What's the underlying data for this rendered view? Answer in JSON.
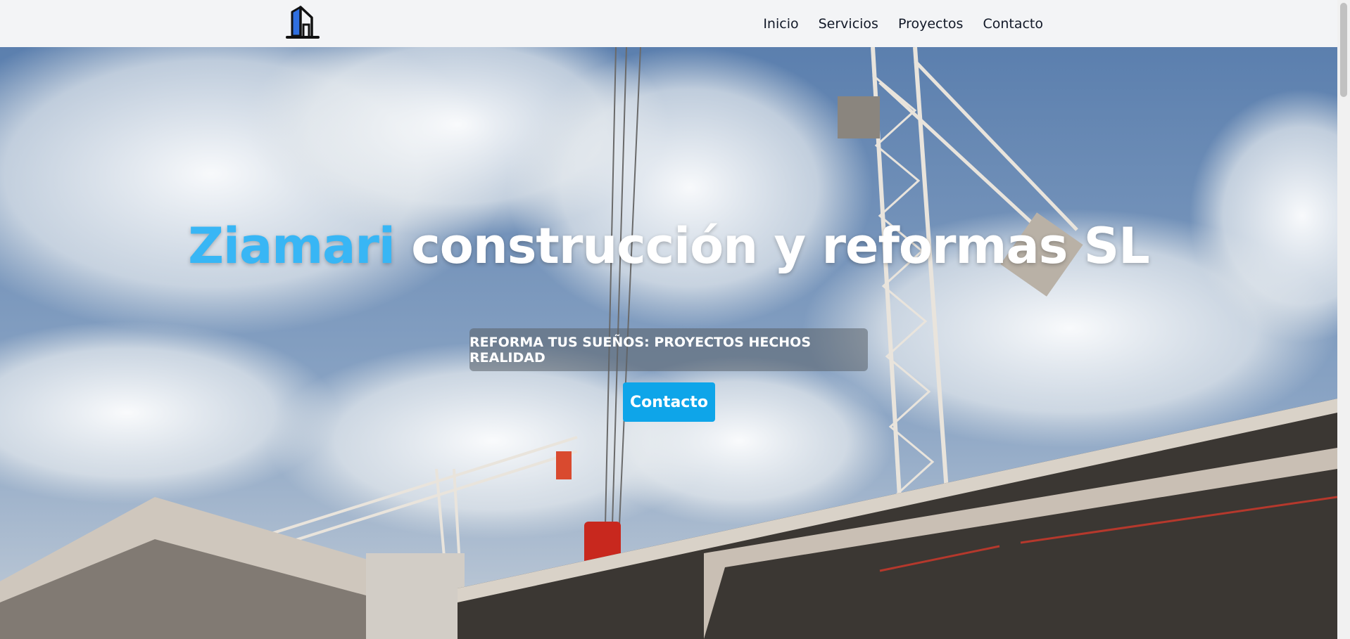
{
  "header": {
    "logo_icon": "building-icon",
    "nav": [
      {
        "label": "Inicio"
      },
      {
        "label": "Servicios"
      },
      {
        "label": "Proyectos"
      },
      {
        "label": "Contacto"
      }
    ]
  },
  "hero": {
    "title_brand": "Ziamari",
    "title_rest": " construcción y reformas SL",
    "subtitle": "REFORMA TUS SUEÑOS: PROYECTOS HECHOS REALIDAD",
    "cta_label": "Contacto",
    "background": "construction-site-with-cranes-image"
  },
  "colors": {
    "brand_blue": "#38b6f5",
    "cta_blue": "#0ea5e9",
    "header_bg": "#f3f4f6"
  }
}
